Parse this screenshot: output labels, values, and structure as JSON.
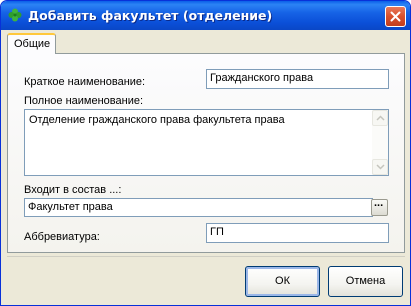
{
  "window": {
    "title": "Добавить факультет (отделение)",
    "close_label": "close"
  },
  "tabs": [
    {
      "label": "Общие",
      "selected": true
    }
  ],
  "form": {
    "short_name": {
      "label": "Краткое наименование:",
      "value": "Гражданского права"
    },
    "full_name": {
      "label": "Полное наименование:",
      "value": "Отделение гражданского права факультета права"
    },
    "parent": {
      "label": "Входит в состав ...:",
      "value": "Факультет права",
      "lookup_label": "..."
    },
    "abbreviation": {
      "label": "Аббревиатура:",
      "value": "ГП"
    }
  },
  "buttons": {
    "ok": "ОК",
    "cancel": "Отмена"
  },
  "colors": {
    "titlebar": "#0a5fe8",
    "dialog_bg": "#ece9d8",
    "field_border": "#7f9db9",
    "tab_highlight": "#ffc83c"
  }
}
